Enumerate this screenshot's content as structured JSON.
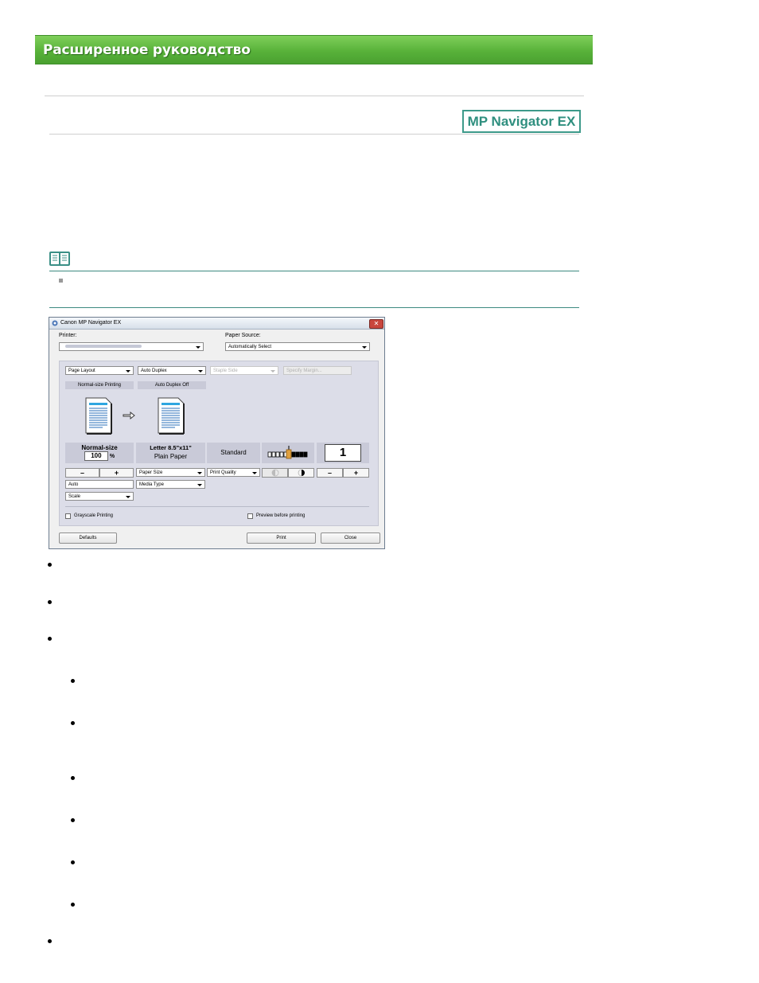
{
  "header": {
    "title": "Расширенное руководство"
  },
  "product_badge": "MP Navigator EX",
  "note": {
    "icon": "book-icon"
  },
  "dialog": {
    "title": "Canon MP Navigator EX",
    "printer_label": "Printer:",
    "printer_value": "",
    "paper_source_label": "Paper Source:",
    "paper_source_value": "Automatically Select",
    "page_layout": "Page Layout",
    "auto_duplex": "Auto Duplex",
    "staple_side": "Staple Side",
    "specify_margin": "Specify Margin...",
    "normal_size_printing": "Normal-size Printing",
    "auto_duplex_off": "Auto Duplex Off",
    "scale_title": "Normal-size",
    "scale_value": "100",
    "scale_unit": "%",
    "paper_size_value": "Letter 8.5\"x11\"",
    "media_type_value": "Plain Paper",
    "quality_value": "Standard",
    "copies_value": "1",
    "minus": "–",
    "plus": "+",
    "paper_size": "Paper Size",
    "print_quality": "Print Quality",
    "auto": "Auto",
    "media_type": "Media Type",
    "scale": "Scale",
    "grayscale": "Grayscale Printing",
    "preview": "Preview before printing",
    "defaults_btn": "Defaults",
    "print_btn": "Print",
    "close_btn": "Close"
  },
  "colors": {
    "banner_green": "#58b23a",
    "badge_teal": "#3d9a8a",
    "rule_teal": "#3d8a80"
  }
}
